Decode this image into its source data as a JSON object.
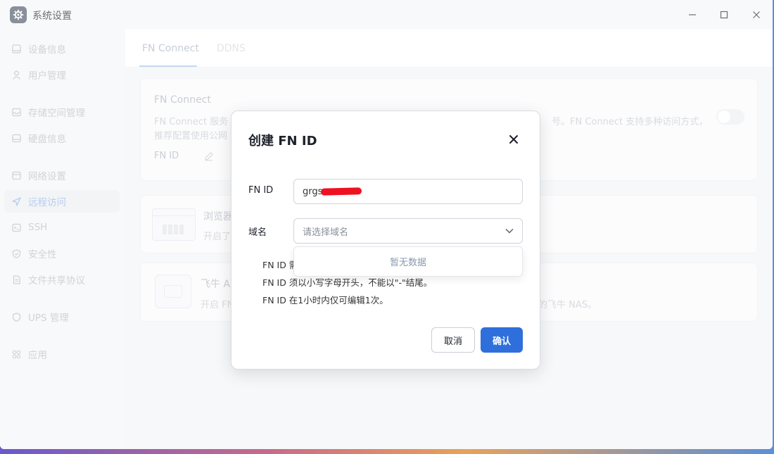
{
  "window": {
    "title": "系统设置"
  },
  "sidebar": {
    "items": [
      {
        "label": "设备信息",
        "icon": "device-icon"
      },
      {
        "label": "用户管理",
        "icon": "user-icon"
      },
      {
        "label": "存储空间管理",
        "icon": "storage-icon"
      },
      {
        "label": "硬盘信息",
        "icon": "disk-icon"
      },
      {
        "label": "网络设置",
        "icon": "network-icon"
      },
      {
        "label": "远程访问",
        "icon": "send-icon",
        "active": true
      },
      {
        "label": "SSH",
        "icon": "terminal-icon"
      },
      {
        "label": "安全性",
        "icon": "shield-icon"
      },
      {
        "label": "文件共享协议",
        "icon": "file-icon"
      },
      {
        "label": "UPS 管理",
        "icon": "ups-shield-icon"
      },
      {
        "label": "应用",
        "icon": "apps-icon"
      }
    ]
  },
  "main": {
    "tabs": [
      {
        "label": "FN Connect",
        "active": true
      },
      {
        "label": "DDNS",
        "active": false
      }
    ],
    "card1": {
      "title": "FN Connect",
      "desc_left": "FN Connect 服务",
      "desc_right": "号。FN Connect 支持多种访问方式，",
      "desc_line2": "推荐配置使用公网",
      "fnid_label": "FN ID"
    },
    "card2": {
      "title": "浏览器",
      "desc": "开启了"
    },
    "card3": {
      "title": "飞牛 Ap",
      "desc": "开启 FN",
      "desc_right": "的飞牛 NAS。"
    }
  },
  "dialog": {
    "title": "创建 FN ID",
    "fnid_label": "FN ID",
    "fnid_value": "grgs",
    "domain_label": "域名",
    "domain_placeholder": "请选择域名",
    "dropdown_empty": "暂无数据",
    "hints": [
      "FN ID 需",
      "FN ID 须以小写字母开头，不能以\"-\"结尾。",
      "FN ID 在1小时内仅可编辑1次。"
    ],
    "cancel_label": "取消",
    "confirm_label": "确认"
  }
}
